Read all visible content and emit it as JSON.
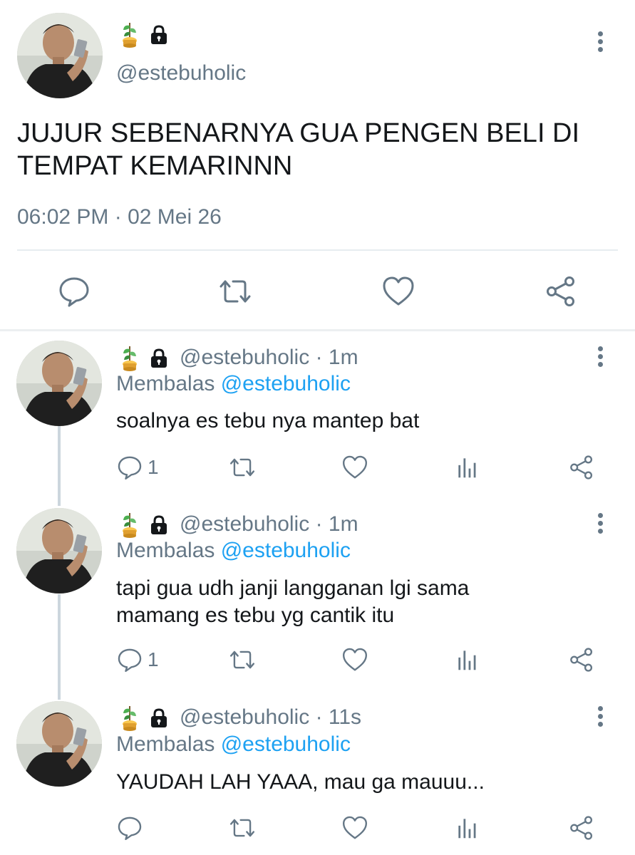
{
  "main_tweet": {
    "handle": "@estebuholic",
    "text": "JUJUR SEBENARNYA GUA PENGEN BELI DI TEMPAT KEMARINNN",
    "timestamp": "06:02 PM · 02 Mei 26"
  },
  "replies": [
    {
      "handle": "@estebuholic",
      "time": "1m",
      "reply_prefix": "Membalas ",
      "reply_to": "@estebuholic",
      "text": "soalnya es tebu nya mantep bat",
      "reply_count": "1"
    },
    {
      "handle": "@estebuholic",
      "time": "1m",
      "reply_prefix": "Membalas ",
      "reply_to": "@estebuholic",
      "text": "tapi gua udh janji langganan lgi sama mamang es tebu yg cantik itu",
      "reply_count": "1"
    },
    {
      "handle": "@estebuholic",
      "time": "11s",
      "reply_prefix": "Membalas ",
      "reply_to": "@estebuholic",
      "text": "YAUDAH LAH YAAA, mau ga mauuu...",
      "reply_count": ""
    }
  ],
  "separator": " · ",
  "icons": {
    "reply": "speech-bubble-icon",
    "retweet": "retweet-icon",
    "like": "heart-icon",
    "share": "share-icon",
    "analytics": "bar-chart-icon",
    "more": "vertical-dots-icon",
    "lock": "lock-icon",
    "plant": "plant-emoji-icon"
  },
  "colors": {
    "text": "#14171a",
    "secondary": "#657786",
    "mention": "#1da1f2",
    "divider": "#e6ecf0"
  }
}
